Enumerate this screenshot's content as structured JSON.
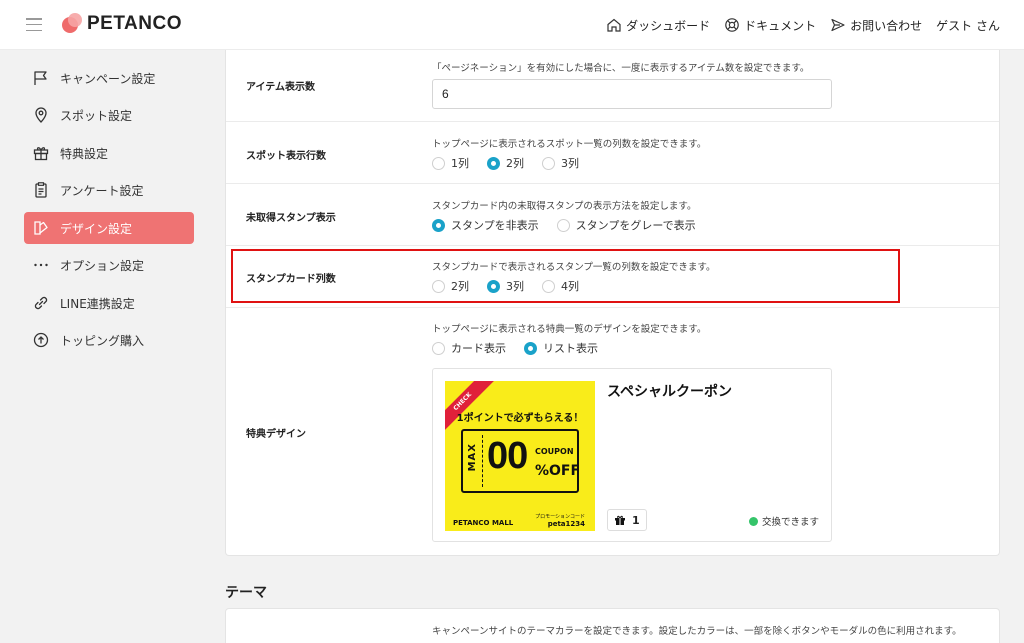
{
  "header": {
    "brand": "PETANCO",
    "nav": [
      {
        "label": "ダッシュボード",
        "icon": "home-icon"
      },
      {
        "label": "ドキュメント",
        "icon": "help-icon"
      },
      {
        "label": "お問い合わせ",
        "icon": "send-icon"
      }
    ],
    "user": "ゲスト さん"
  },
  "sidebar": {
    "items": [
      {
        "label": "キャンペーン設定",
        "icon": "flag-icon"
      },
      {
        "label": "スポット設定",
        "icon": "map-pin-icon"
      },
      {
        "label": "特典設定",
        "icon": "gift-icon"
      },
      {
        "label": "アンケート設定",
        "icon": "clipboard-icon"
      },
      {
        "label": "デザイン設定",
        "icon": "palette-icon",
        "active": true
      },
      {
        "label": "オプション設定",
        "icon": "more-icon"
      },
      {
        "label": "LINE連携設定",
        "icon": "link-icon"
      },
      {
        "label": "トッピング購入",
        "icon": "arrow-up-circle-icon"
      }
    ]
  },
  "settings": {
    "item_count": {
      "label": "アイテム表示数",
      "desc": "「ページネーション」を有効にした場合に、一度に表示するアイテム数を設定できます。",
      "value": "6"
    },
    "spot_columns": {
      "label": "スポット表示行数",
      "desc": "トップページに表示されるスポット一覧の列数を設定できます。",
      "options": [
        "1列",
        "2列",
        "3列"
      ],
      "selected": "2列"
    },
    "unacquired_stamp": {
      "label": "未取得スタンプ表示",
      "desc": "スタンプカード内の未取得スタンプの表示方法を設定します。",
      "options": [
        "スタンプを非表示",
        "スタンプをグレーで表示"
      ],
      "selected": "スタンプを非表示"
    },
    "stamp_card_columns": {
      "label": "スタンプカード列数",
      "desc": "スタンプカードで表示されるスタンプ一覧の列数を設定できます。",
      "options": [
        "2列",
        "3列",
        "4列"
      ],
      "selected": "3列"
    },
    "reward_design": {
      "label": "特典デザイン",
      "desc": "トップページに表示される特典一覧のデザインを設定できます。",
      "options": [
        "カード表示",
        "リスト表示"
      ],
      "selected": "リスト表示"
    }
  },
  "coupon_preview": {
    "ribbon": "CHECK",
    "headline": "1ポイントで必ずもらえる！",
    "max": "MAX",
    "big": "00",
    "coupon_word": "COUPON",
    "off": "%OFF",
    "promo_label": "プロモーションコード",
    "promo_code": "peta1234",
    "mall": "PETANCO MALL",
    "title": "スペシャルクーポン",
    "count": "1",
    "status": "交換できます",
    "status_color": "#35c46a"
  },
  "theme": {
    "title": "テーマ",
    "desc": "キャンペーンサイトのテーマカラーを設定できます。設定したカラーは、一部を除くボタンやモーダルの色に利用されます。"
  },
  "colors": {
    "accent": "#ef7373",
    "radio": "#1aa2c9",
    "highlight": "#e01212"
  }
}
